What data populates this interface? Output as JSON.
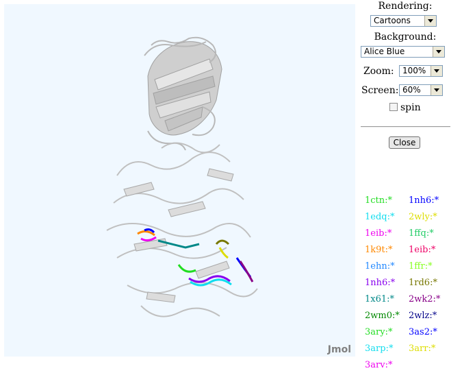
{
  "controls": {
    "rendering_label": "Rendering:",
    "rendering_value": "Cartoons",
    "background_label": "Background:",
    "background_value": "Alice Blue",
    "zoom_label": "Zoom:",
    "zoom_value": "100%",
    "screen_label": "Screen:",
    "screen_value": "60%",
    "spin_label": "spin",
    "close_label": "Close"
  },
  "viewer": {
    "watermark": "Jmol",
    "background": "#f0f8ff"
  },
  "legend": [
    {
      "label": "1ctn:*",
      "color": "#22dd22"
    },
    {
      "label": "1nh6:*",
      "color": "#0000ff"
    },
    {
      "label": "1edq:*",
      "color": "#11ddee"
    },
    {
      "label": "2wly:*",
      "color": "#dddd00"
    },
    {
      "label": "1eib:*",
      "color": "#ee00ee"
    },
    {
      "label": "1ffq:*",
      "color": "#22cc66"
    },
    {
      "label": "1k9t:*",
      "color": "#ff8800"
    },
    {
      "label": "1eib:*",
      "color": "#ee0066"
    },
    {
      "label": "1ehn:*",
      "color": "#2288ff"
    },
    {
      "label": "1ffr:*",
      "color": "#88ff22"
    },
    {
      "label": "1nh6:*",
      "color": "#8800ee"
    },
    {
      "label": "1rd6:*",
      "color": "#777700"
    },
    {
      "label": "1x61:*",
      "color": "#008888"
    },
    {
      "label": "2wk2:*",
      "color": "#880088"
    },
    {
      "label": "2wm0:*",
      "color": "#008800"
    },
    {
      "label": "2wlz:*",
      "color": "#000088"
    },
    {
      "label": "3ary:*",
      "color": "#22dd22"
    },
    {
      "label": "3as2:*",
      "color": "#0000ff"
    },
    {
      "label": "3arp:*",
      "color": "#11ddee"
    },
    {
      "label": "3arr:*",
      "color": "#dddd00"
    },
    {
      "label": "3arv:*",
      "color": "#ee00ee"
    }
  ]
}
